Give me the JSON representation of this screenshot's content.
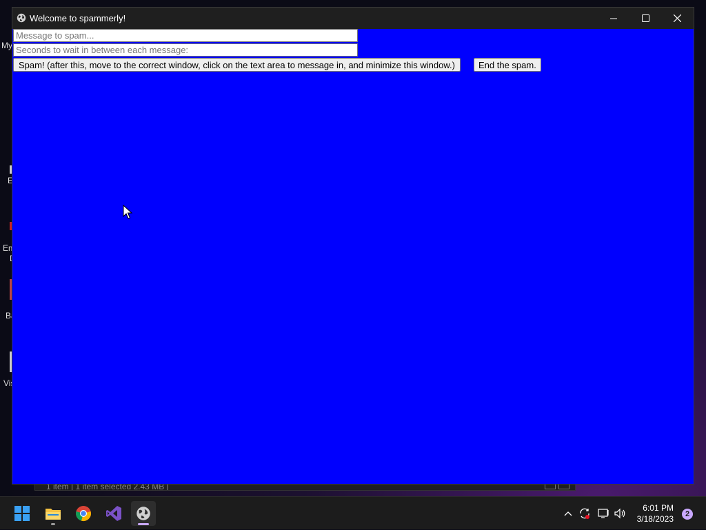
{
  "desktop": {
    "icon_labels": [
      "My",
      "E",
      "Em",
      "D",
      "Ba",
      "Vis"
    ]
  },
  "background_window": {
    "status_text": "1 item   |   1 item selected  2.43 MB   |"
  },
  "window": {
    "title": "Welcome to spammerly!",
    "background_color": "#0000fe",
    "message_input": {
      "value": "",
      "placeholder": "Message to spam..."
    },
    "seconds_input": {
      "value": "",
      "placeholder": "Seconds to wait in between each message:"
    },
    "spam_button_label": "Spam! (after this, move to the correct window, click on the text area to message in, and minimize this window.)",
    "end_button_label": "End the spam."
  },
  "taskbar": {
    "apps": [
      {
        "name": "start",
        "icon": "windows-logo-icon"
      },
      {
        "name": "file-explorer",
        "icon": "folder-icon"
      },
      {
        "name": "chrome",
        "icon": "chrome-icon"
      },
      {
        "name": "visual-studio",
        "icon": "visual-studio-icon"
      },
      {
        "name": "spammerly",
        "icon": "globe-icon"
      }
    ],
    "time": "6:01 PM",
    "date": "3/18/2023",
    "notification_count": "2"
  }
}
